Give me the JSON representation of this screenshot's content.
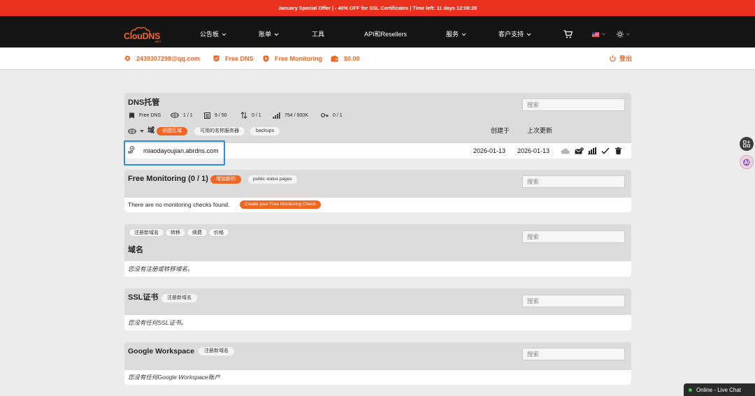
{
  "colors": {
    "banner_bg": "#e8321e",
    "nav_bg": "#141414",
    "accent": "#f26522",
    "highlight": "#2d8be6",
    "page_bg": "#ececec",
    "panel_header_bg": "#dcdcdc",
    "online": "#2ecc40"
  },
  "banner": {
    "text": "January Special Offer | - 40% OFF for SSL Certificates | Time left: 11 days 12:08:28"
  },
  "logo": {
    "name": "ClouDNS",
    "suffix": "NET"
  },
  "nav": {
    "items": [
      {
        "label": "公告板",
        "has_dropdown": true
      },
      {
        "label": "账单",
        "has_dropdown": true
      },
      {
        "label": "工具",
        "has_dropdown": false
      },
      {
        "label": "API和Resellers",
        "has_dropdown": false
      },
      {
        "label": "服务",
        "has_dropdown": true
      },
      {
        "label": "客户支持",
        "has_dropdown": true
      }
    ],
    "icons": [
      "cart-icon",
      "us-flag-icon",
      "sun-icon"
    ]
  },
  "account_bar": {
    "email": "2439307298@qq.com",
    "plan": "Free DNS",
    "monitoring": "Free Monitoring",
    "balance": "$0.00",
    "logout": "登出"
  },
  "dns_hosting": {
    "title": "DNS托管",
    "search_placeholder": "搜索",
    "stats": [
      {
        "icon": "plan-icon",
        "value": "Free DNS"
      },
      {
        "icon": "zones-icon",
        "value": "1 / 1"
      },
      {
        "icon": "records-icon",
        "value": "9 / 50"
      },
      {
        "icon": "transfer-icon",
        "value": "0 / 1"
      },
      {
        "icon": "queries-icon",
        "value": "754 / 500K"
      },
      {
        "icon": "key-icon",
        "value": "0 / 1"
      }
    ],
    "section_label": "域",
    "buttons": {
      "create_zone": "创建区域",
      "nameservers": "可用的名称服务器",
      "backups": "backups"
    },
    "columns": {
      "created": "创建于",
      "updated": "上次更新"
    },
    "zones": [
      {
        "badge": "MP",
        "domain": "miaodayoujian.abrdns.com",
        "created": "2026-01-13",
        "updated": "2026-01-13",
        "actions": [
          "cloud-icon",
          "mail-settings-icon",
          "stats-icon",
          "check-icon",
          "trash-icon"
        ]
      }
    ]
  },
  "monitoring": {
    "title": "Free Monitoring (0 / 1)",
    "add_button": "增加新的",
    "status_pages_button": "public status pages",
    "search_placeholder": "搜索",
    "empty_text": "There are no monitoring checks found.",
    "create_button": "Create your Free Monitoring Check"
  },
  "domains": {
    "tabs": [
      "注册新域名",
      "转移",
      "续费",
      "价格"
    ],
    "title": "域名",
    "search_placeholder": "搜索",
    "empty_text": "您没有注册或转移域名。"
  },
  "ssl": {
    "title": "SSL证书",
    "register_button": "注册新域名",
    "search_placeholder": "搜索",
    "empty_text": "您没有任何SSL证书。"
  },
  "google_workspace": {
    "title": "Google Workspace",
    "register_button": "注册新域名",
    "search_placeholder": "搜索",
    "empty_text": "您没有任何Google Workspace账户"
  },
  "side_buttons": [
    "apps-icon",
    "translate-icon"
  ],
  "live_chat": {
    "label": "Online - Live Chat"
  }
}
